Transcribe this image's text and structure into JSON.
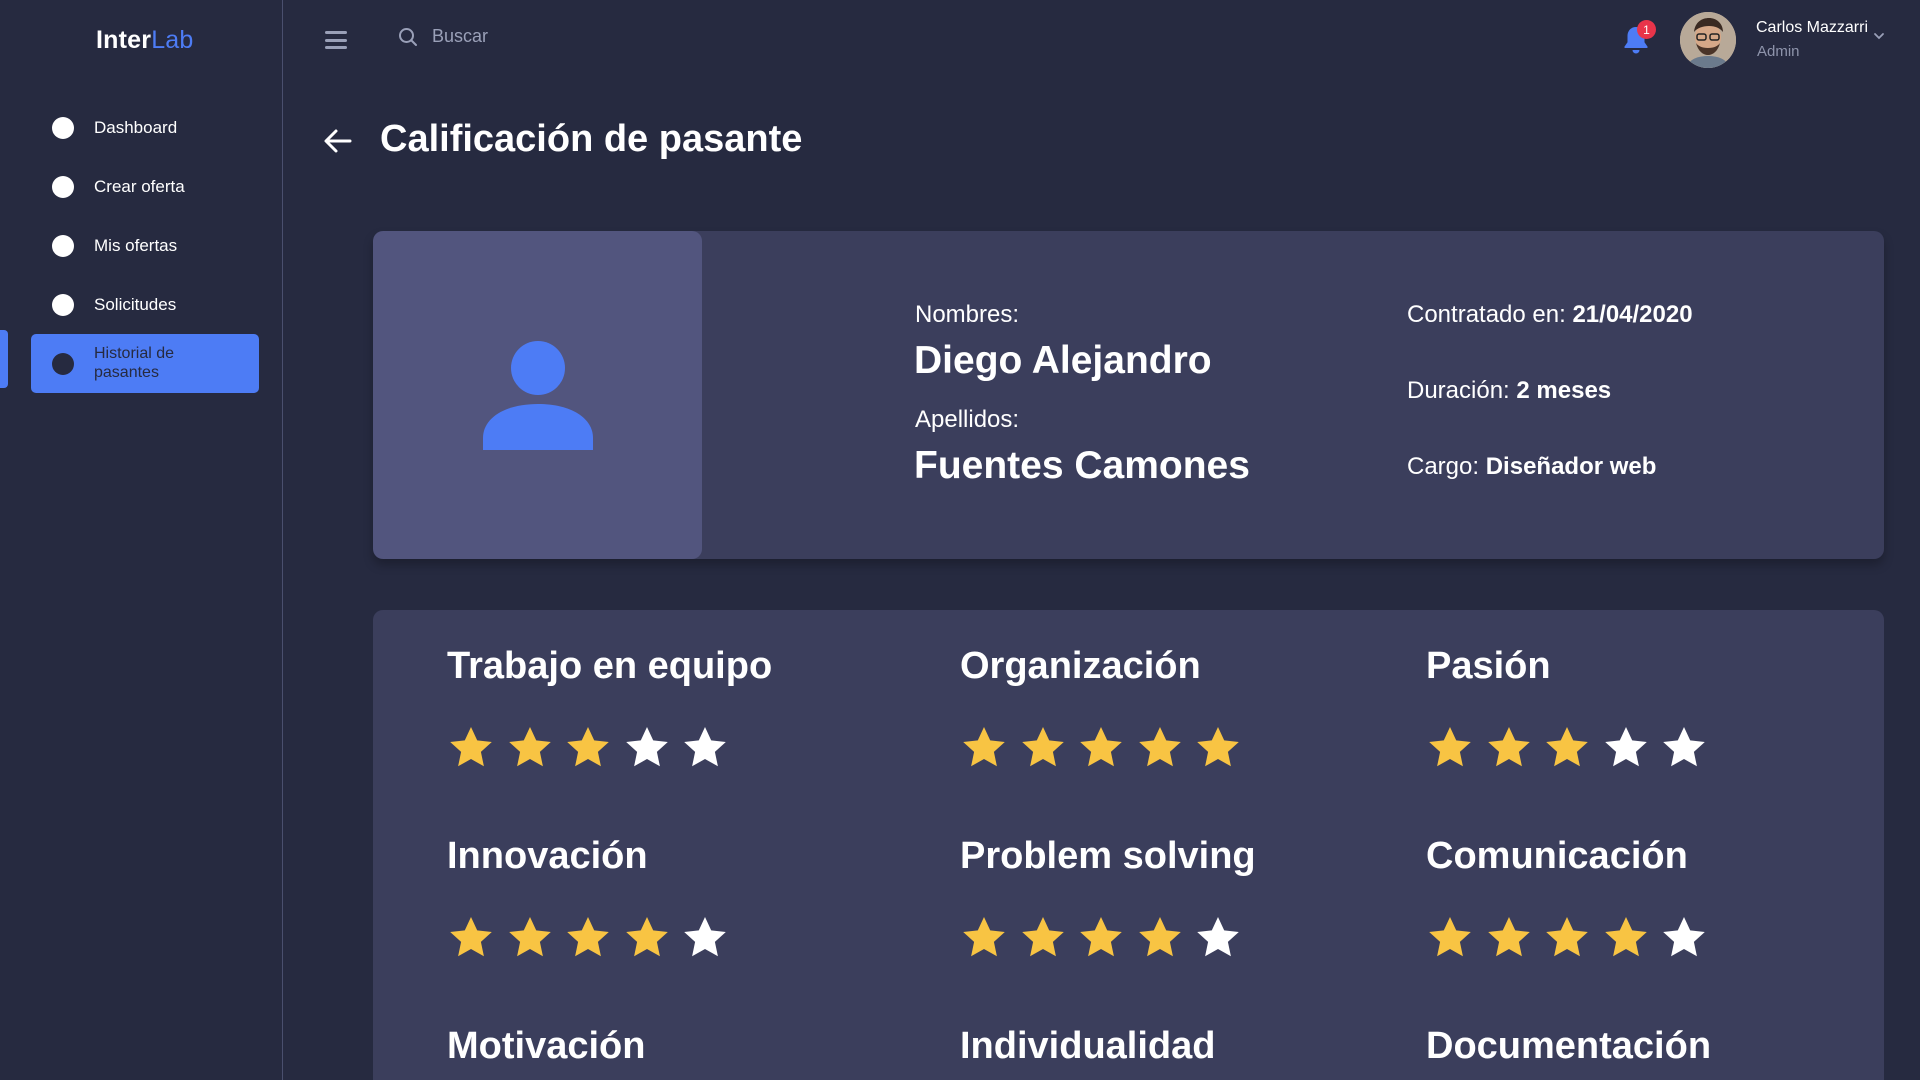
{
  "app": {
    "logo_part1": "Inter",
    "logo_part2": "Lab",
    "accent_color": "#4d7cf5",
    "background": "#262a40",
    "card_color": "#3b3e5c"
  },
  "sidebar": {
    "items": [
      {
        "label": "Dashboard"
      },
      {
        "label": "Crear oferta"
      },
      {
        "label": "Mis ofertas"
      },
      {
        "label": "Solicitudes"
      },
      {
        "label": "Historial de pasantes",
        "active": true
      }
    ]
  },
  "header": {
    "menu_icon": "hamburger-icon",
    "search_placeholder": "Buscar",
    "search_icon": "search-icon",
    "notification_count": "1",
    "notification_icon": "bell-icon",
    "user_name": "Carlos Mazzarri",
    "user_role": "Admin"
  },
  "page": {
    "title": "Calificación de pasante"
  },
  "profile": {
    "names_label": "Nombres:",
    "names": "Diego Alejandro",
    "surnames_label": "Apellidos:",
    "surnames": "Fuentes Camones",
    "hired_label": "Contratado en:",
    "hired_value": "21/04/2020",
    "duration_label": "Duración:",
    "duration_value": "2 meses",
    "role_label": "Cargo:",
    "role_value": "Diseñador web"
  },
  "ratings": [
    {
      "skill": "Trabajo en equipo",
      "score": 3,
      "max": 5
    },
    {
      "skill": "Organización",
      "score": 5,
      "max": 5
    },
    {
      "skill": "Pasión",
      "score": 3,
      "max": 5
    },
    {
      "skill": "Innovación",
      "score": 4,
      "max": 5
    },
    {
      "skill": "Problem solving",
      "score": 4,
      "max": 5
    },
    {
      "skill": "Comunicación",
      "score": 4,
      "max": 5
    },
    {
      "skill": "Motivación",
      "score": null,
      "max": 5
    },
    {
      "skill": "Individualidad",
      "score": null,
      "max": 5
    },
    {
      "skill": "Documentación",
      "score": null,
      "max": 5
    }
  ],
  "star_colors": {
    "filled": "#f8c443",
    "empty": "#ffffff"
  }
}
